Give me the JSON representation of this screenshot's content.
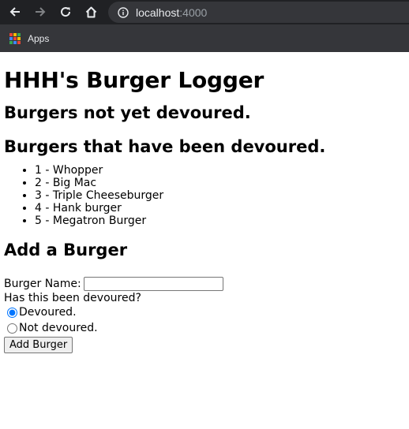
{
  "browser": {
    "url_host": "localhost",
    "url_port": ":4000",
    "bookmarks": [
      {
        "label": "Apps",
        "icon": "apps-grid-icon"
      }
    ],
    "icons": [
      "back-arrow-icon",
      "forward-arrow-icon",
      "reload-icon",
      "home-icon",
      "info-icon"
    ],
    "colors": {
      "chrome": "#202124",
      "toolbar": "#35363a",
      "text": "#e8eaed"
    }
  },
  "page": {
    "title": "HHH's Burger Logger",
    "not_devoured_heading": "Burgers not yet devoured.",
    "devoured_heading": "Burgers that have been devoured.",
    "devoured_burgers": [
      "1 - Whopper",
      "2 - Big Mac",
      "3 - Triple Cheeseburger",
      "4 - Hank burger",
      "5 - Megatron Burger"
    ],
    "add_heading": "Add a Burger",
    "form": {
      "name_label": "Burger Name:",
      "name_value": "",
      "question": "Has this been devoured?",
      "option_devoured": "Devoured.",
      "option_not_devoured": "Not devoured.",
      "selected_option": "Devoured.",
      "submit_label": "Add Burger"
    }
  }
}
